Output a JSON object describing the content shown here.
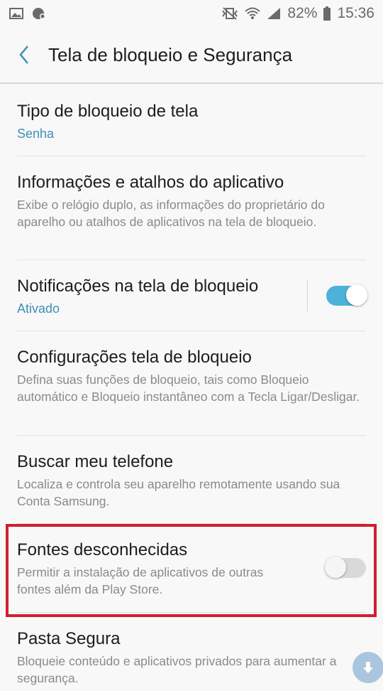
{
  "status_bar": {
    "battery_percent": "82%",
    "time": "15:36",
    "left_icons": [
      "image-icon",
      "chat-settings-icon"
    ],
    "right_icons": [
      "vibrate-icon",
      "wifi-icon",
      "signal-icon",
      "battery-icon"
    ]
  },
  "app_bar": {
    "title": "Tela de bloqueio e Segurança",
    "back_icon": "chevron-left-icon"
  },
  "settings": [
    {
      "id": "tipo-bloqueio",
      "title": "Tipo de bloqueio de tela",
      "subtitle": "Senha",
      "subtitle_accent": true
    },
    {
      "id": "info-atalhos",
      "title": "Informações e atalhos do aplicativo",
      "subtitle": "Exibe o relógio duplo, as informações do proprietário do aparelho ou atalhos de aplicativos na tela de bloqueio."
    },
    {
      "id": "notificacoes",
      "title": "Notificações na tela de bloqueio",
      "subtitle": "Ativado",
      "subtitle_accent": true,
      "toggle": true,
      "toggle_on": true
    },
    {
      "id": "configuracoes",
      "title": "Configurações tela de bloqueio",
      "subtitle": "Defina suas funções de bloqueio, tais como Bloqueio automático e Bloqueio instantâneo com a Tecla Ligar/Desligar."
    },
    {
      "id": "buscar-telefone",
      "title": "Buscar meu telefone",
      "subtitle": "Localiza e controla seu aparelho remotamente usando sua Conta Samsung."
    },
    {
      "id": "fontes-desconhecidas",
      "title": "Fontes desconhecidas",
      "subtitle": "Permitir a instalação de aplicativos de outras fontes além da Play Store.",
      "toggle": true,
      "toggle_on": false,
      "highlighted": true
    },
    {
      "id": "pasta-segura",
      "title": "Pasta Segura",
      "subtitle": "Bloqueie conteúdo e aplicativos privados para aumentar a segurança."
    }
  ],
  "colors": {
    "accent": "#3c8fb5",
    "toggle_on": "#4cb2d8",
    "highlight_border": "#d01f2f"
  },
  "fab_icon": "arrow-down-icon"
}
